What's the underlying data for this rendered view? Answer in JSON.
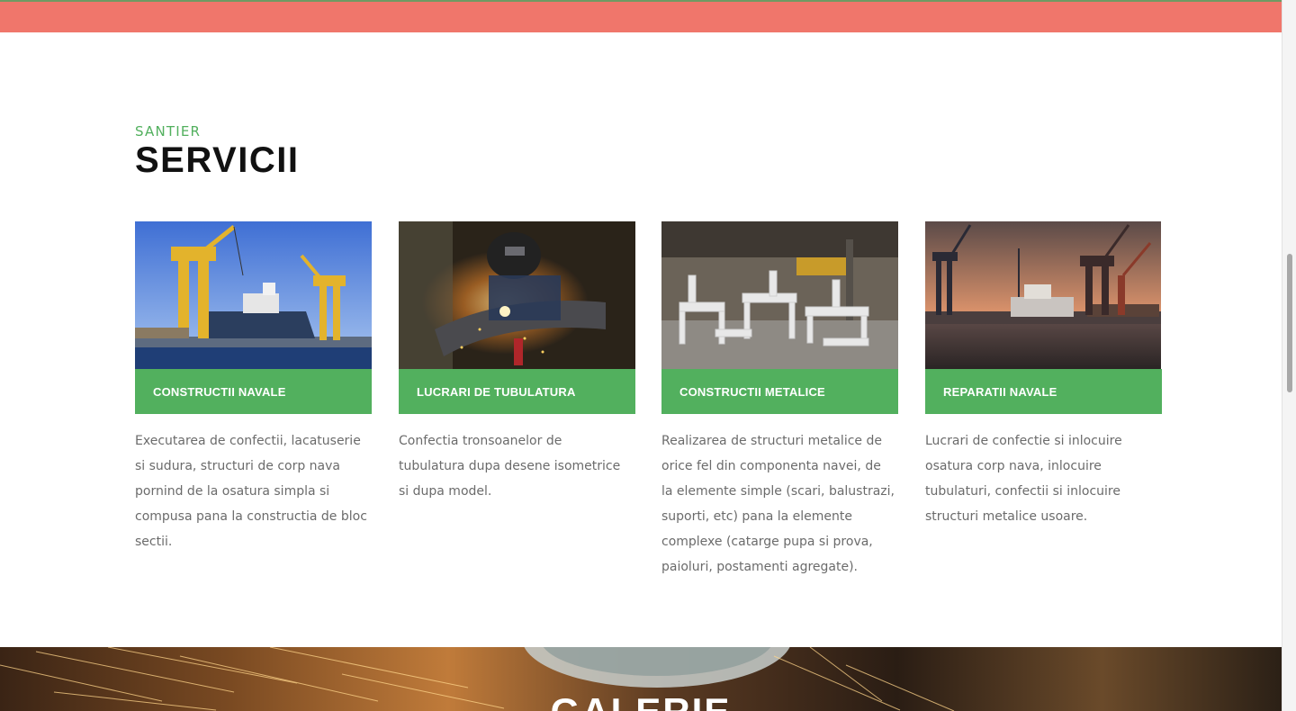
{
  "section": {
    "eyebrow": "SANTIER",
    "title": "SERVICII"
  },
  "services": [
    {
      "label": "CONSTRUCTII NAVALE",
      "description": "Executarea de confectii, lacatuserie si sudura, structuri de corp nava pornind de la osatura simpla si compusa pana la constructia de bloc sectii.",
      "image": "shipyard-cranes-photo"
    },
    {
      "label": "LUCRARI DE TUBULATURA",
      "description": "Confectia tronsoanelor de tubulatura dupa desene isometrice si dupa model.",
      "image": "welder-pipe-photo"
    },
    {
      "label": "CONSTRUCTII METALICE",
      "description": "Realizarea de structuri metalice de orice fel din componenta navei, de la elemente simple (scari, balustrazi, suporti, etc) pana la elemente complexe (catarge pupa si prova, paioluri, postamenti agregate).",
      "image": "metal-structures-photo"
    },
    {
      "label": "REPARATII NAVALE",
      "description": "Lucrari de confectie si inlocuire osatura corp nava, inlocuire tubulaturi, confectii si inlocuire structuri metalice usoare.",
      "image": "harbor-sunset-photo"
    }
  ],
  "banner": {
    "title": "GALERIE"
  },
  "colors": {
    "accent": "#52b05e",
    "topbar": "#f0766b"
  }
}
